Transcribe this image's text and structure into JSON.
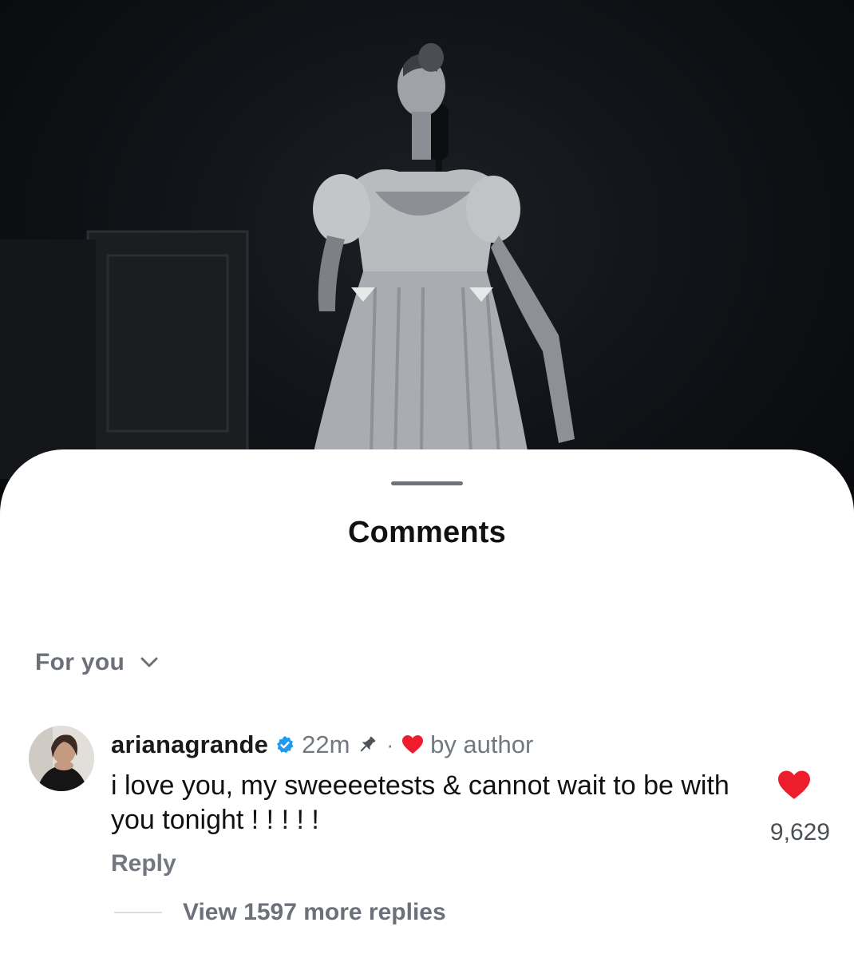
{
  "sheet": {
    "title": "Comments",
    "sort_label": "For you",
    "sort_icon": "chevron-down-icon"
  },
  "comment": {
    "username": "arianagrande",
    "verified": true,
    "verified_color": "#1d9bf0",
    "time": "22m",
    "pinned": true,
    "separator": "·",
    "author_liked_label": "by author",
    "text": "i love you, my sweeeetests & cannot wait to be with you tonight ! ! ! ! !",
    "reply_label": "Reply",
    "likes": "9,629",
    "liked": true,
    "heart_color": "#ee1d2d",
    "view_replies_label": "View 1597 more replies"
  }
}
